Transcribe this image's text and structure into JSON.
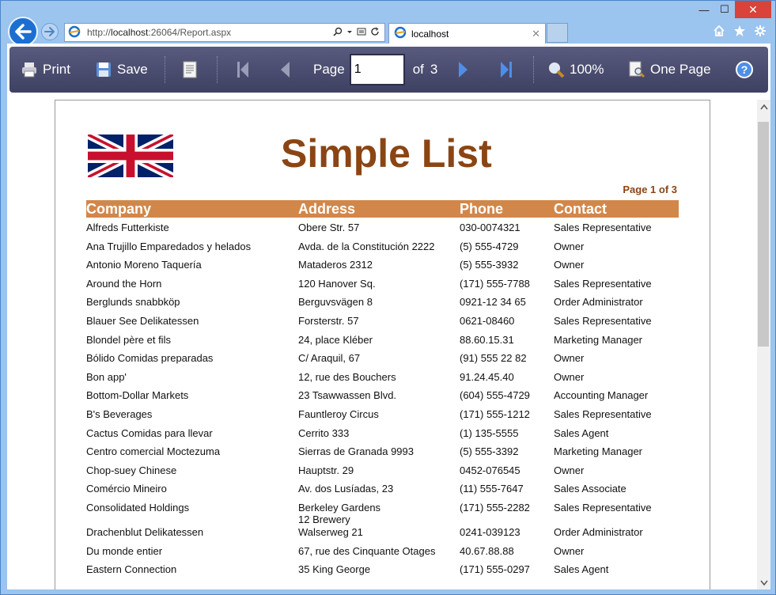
{
  "window": {
    "min_glyph": "—",
    "max_glyph": "☐",
    "close_glyph": "✕"
  },
  "browser": {
    "url_prefix": "http://",
    "url_host": "localhost",
    "url_rest": ":26064/Report.aspx",
    "tab_title": "localhost",
    "tab_close": "✕"
  },
  "toolbar": {
    "print_label": "Print",
    "save_label": "Save",
    "page_label": "Page",
    "page_value": "1",
    "of_label": "of",
    "total_pages": "3",
    "zoom_label": "100%",
    "view_mode_label": "One Page",
    "help_label": "?"
  },
  "report": {
    "title": "Simple List",
    "page_indicator": "Page 1 of 3",
    "columns": {
      "company": "Company",
      "address": "Address",
      "phone": "Phone",
      "contact": "Contact"
    },
    "rows": [
      {
        "company": "Alfreds Futterkiste",
        "address": "Obere Str. 57",
        "phone": "030-0074321",
        "contact": "Sales Representative"
      },
      {
        "company": "Ana Trujillo Emparedados y helados",
        "address": "Avda. de la Constitución 2222",
        "phone": "(5) 555-4729",
        "contact": "Owner"
      },
      {
        "company": "Antonio Moreno Taquería",
        "address": "Mataderos 2312",
        "phone": "(5) 555-3932",
        "contact": "Owner"
      },
      {
        "company": "Around the Horn",
        "address": "120 Hanover Sq.",
        "phone": "(171) 555-7788",
        "contact": "Sales Representative"
      },
      {
        "company": "Berglunds snabbköp",
        "address": "Berguvsvägen 8",
        "phone": "0921-12 34 65",
        "contact": "Order Administrator"
      },
      {
        "company": "Blauer See Delikatessen",
        "address": "Forsterstr. 57",
        "phone": "0621-08460",
        "contact": "Sales Representative"
      },
      {
        "company": "Blondel père et fils",
        "address": "24, place Kléber",
        "phone": "88.60.15.31",
        "contact": "Marketing Manager"
      },
      {
        "company": "Bólido Comidas preparadas",
        "address": "C/ Araquil, 67",
        "phone": "(91) 555 22 82",
        "contact": "Owner"
      },
      {
        "company": "Bon app'",
        "address": "12, rue des Bouchers",
        "phone": "91.24.45.40",
        "contact": "Owner"
      },
      {
        "company": "Bottom-Dollar Markets",
        "address": "23 Tsawwassen Blvd.",
        "phone": "(604) 555-4729",
        "contact": "Accounting Manager"
      },
      {
        "company": "B's Beverages",
        "address": "Fauntleroy Circus",
        "phone": "(171) 555-1212",
        "contact": "Sales Representative"
      },
      {
        "company": "Cactus Comidas para llevar",
        "address": "Cerrito 333",
        "phone": "(1) 135-5555",
        "contact": "Sales Agent"
      },
      {
        "company": "Centro comercial Moctezuma",
        "address": "Sierras de Granada 9993",
        "phone": "(5) 555-3392",
        "contact": "Marketing Manager"
      },
      {
        "company": "Chop-suey Chinese",
        "address": "Hauptstr. 29",
        "phone": "0452-076545",
        "contact": "Owner"
      },
      {
        "company": "Comércio Mineiro",
        "address": "Av. dos Lusíadas, 23",
        "phone": "(11) 555-7647",
        "contact": "Sales Associate"
      },
      {
        "company": "Consolidated Holdings",
        "address": "Berkeley Gardens\n12 Brewery",
        "phone": "(171) 555-2282",
        "contact": "Sales Representative",
        "tall": true
      },
      {
        "company": "Drachenblut Delikatessen",
        "address": "Walserweg 21",
        "phone": "0241-039123",
        "contact": "Order Administrator"
      },
      {
        "company": "Du monde entier",
        "address": "67, rue des Cinquante Otages",
        "phone": "40.67.88.88",
        "contact": "Owner"
      },
      {
        "company": "Eastern Connection",
        "address": "35 King George",
        "phone": "(171) 555-0297",
        "contact": "Sales Agent"
      }
    ]
  },
  "colors": {
    "toolbar_bg": "#4a4c70",
    "header_bg": "#d2874a",
    "title_color": "#8b4513"
  }
}
